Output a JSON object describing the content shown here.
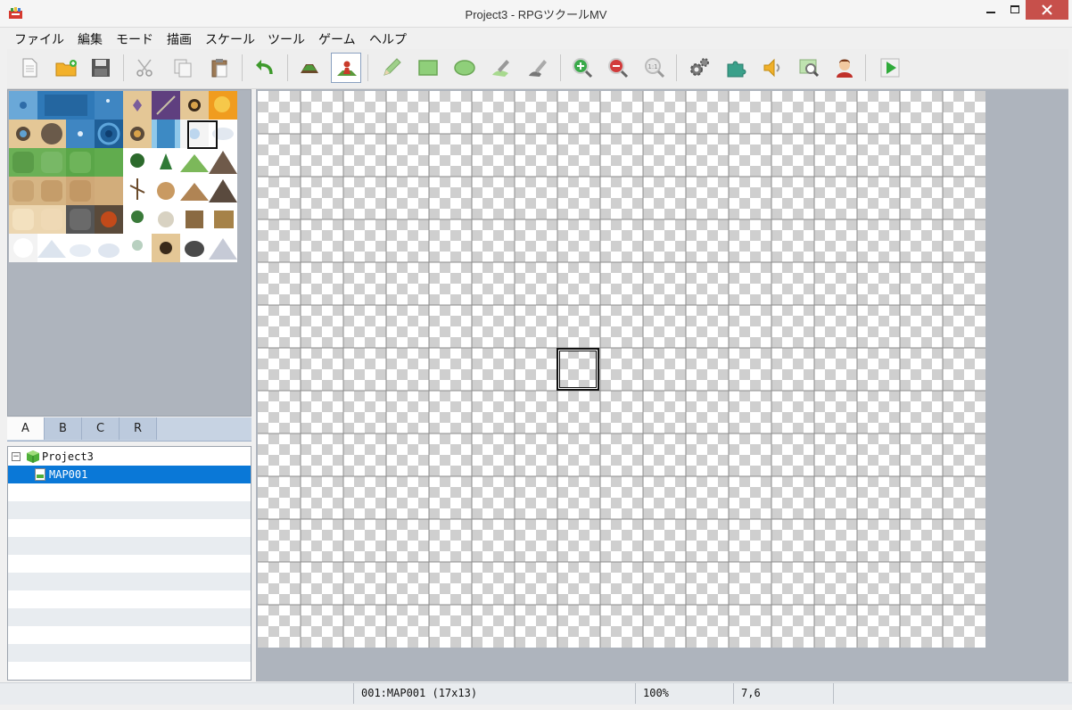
{
  "window": {
    "title": "Project3 - RPGツクールMV",
    "controls": [
      "minimize-icon",
      "maximize-icon",
      "close-icon"
    ],
    "close_color": "#c7504b"
  },
  "menu": {
    "items": [
      "ファイル",
      "編集",
      "モード",
      "描画",
      "スケール",
      "ツール",
      "ゲーム",
      "ヘルプ"
    ]
  },
  "toolbar": {
    "buttons": [
      "new-project-icon",
      "open-project-icon",
      "save-project-icon",
      "cut-icon",
      "copy-icon",
      "paste-icon",
      "undo-icon",
      "map-mode-icon",
      "event-mode-icon",
      "pencil-icon",
      "rectangle-icon",
      "ellipse-icon",
      "fill-icon",
      "shadow-pen-icon",
      "zoom-in-icon",
      "zoom-out-icon",
      "actual-size-icon",
      "database-icon",
      "plugin-manager-icon",
      "sound-test-icon",
      "event-searcher-icon",
      "character-generator-icon",
      "playtest-icon"
    ],
    "active": "event-mode-icon"
  },
  "tileset_tabs": {
    "items": [
      "A",
      "B",
      "C",
      "R"
    ],
    "active": "A"
  },
  "map_tree": {
    "project": "Project3",
    "collapse_symbol": "−",
    "maps": [
      "MAP001"
    ],
    "selected": "MAP001",
    "selection_color": "#0a78d7"
  },
  "map": {
    "columns": 17,
    "rows": 13,
    "cursor_col": 7,
    "cursor_row": 6
  },
  "status": {
    "map_info": "001:MAP001 (17x13)",
    "zoom": "100%",
    "coords": "7,6"
  }
}
